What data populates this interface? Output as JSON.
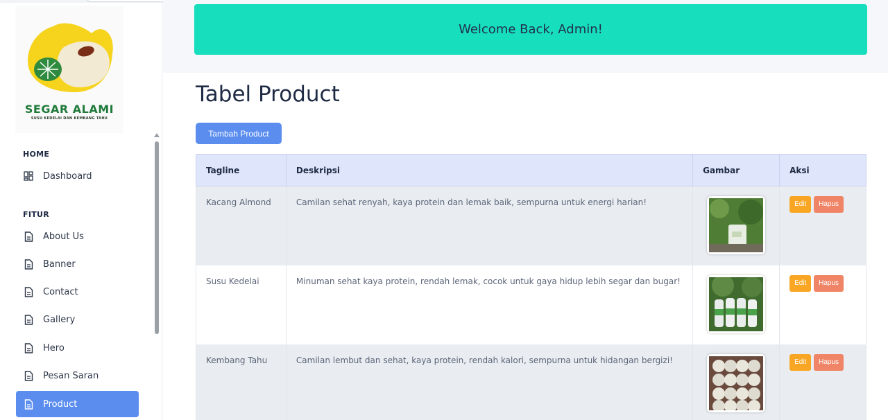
{
  "brand": {
    "name": "SEGAR ALAMI",
    "tagline": "SUSU KEDELAI DAN KEMBANG TAHU"
  },
  "sidebar": {
    "sections": [
      {
        "label": "HOME"
      },
      {
        "label": "FITUR"
      }
    ],
    "items": [
      {
        "label": "Dashboard",
        "icon": "dashboard-grid-icon"
      },
      {
        "label": "About Us",
        "icon": "document-icon"
      },
      {
        "label": "Banner",
        "icon": "document-icon"
      },
      {
        "label": "Contact",
        "icon": "document-icon"
      },
      {
        "label": "Gallery",
        "icon": "document-icon"
      },
      {
        "label": "Hero",
        "icon": "document-icon"
      },
      {
        "label": "Pesan Saran",
        "icon": "document-icon"
      },
      {
        "label": "Product",
        "icon": "document-icon",
        "active": true
      }
    ]
  },
  "header": {
    "welcome": "Welcome Back, Admin!"
  },
  "main": {
    "title": "Tabel Product",
    "add_button": "Tambah Product",
    "table": {
      "columns": [
        "Tagline",
        "Deskripsi",
        "Gambar",
        "Aksi"
      ],
      "rows": [
        {
          "tagline": "Kacang Almond",
          "deskripsi": "Camilan sehat renyah, kaya protein dan lemak baik, sempurna untuk energi harian!",
          "edit": "Edit",
          "hapus": "Hapus"
        },
        {
          "tagline": "Susu Kedelai",
          "deskripsi": "Minuman sehat kaya protein, rendah lemak, cocok untuk gaya hidup lebih segar dan bugar!",
          "edit": "Edit",
          "hapus": "Hapus"
        },
        {
          "tagline": "Kembang Tahu",
          "deskripsi": "Camilan lembut dan sehat, kaya protein, rendah kalori, sempurna untuk hidangan bergizi!",
          "edit": "Edit",
          "hapus": "Hapus"
        }
      ]
    }
  },
  "colors": {
    "accent": "#5b8def",
    "welcome_bg": "#17dfbe",
    "edit": "#f8a623",
    "hapus": "#f08466",
    "table_header": "#dfe6fb"
  }
}
